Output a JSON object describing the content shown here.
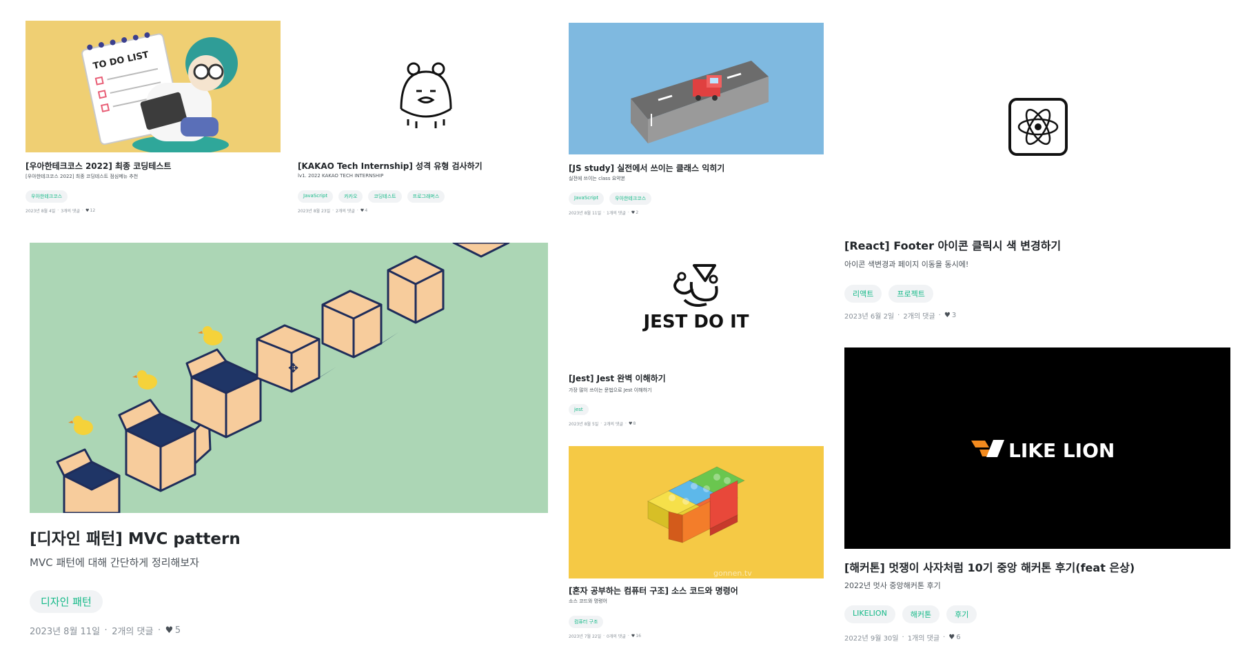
{
  "cards": [
    {
      "id": "woowa",
      "title": "[우아한테크코스 2022] 최종 코딩테스트",
      "desc": "[우아한테크코스 2022] 최종 코딩테스트 점심메뉴 추천",
      "tags": [
        "우아한테크코스"
      ],
      "date": "2023년 8월 4일",
      "comments": "3개의 댓글",
      "likes": "12",
      "thumb_text": "TO DO LIST",
      "thumb_bg": "#efcf73"
    },
    {
      "id": "kakao",
      "title": "[KAKAO Tech Internship] 성격 유형 검사하기",
      "desc": "lv1. 2022 KAKAO TECH INTERNSHIP",
      "tags": [
        "JavaScript",
        "카카오",
        "코딩테스트",
        "프로그래머스"
      ],
      "date": "2023년 8월 23일",
      "comments": "2개의 댓글",
      "likes": "4",
      "thumb_bg": "#ffffff"
    },
    {
      "id": "jsstudy",
      "title": "[JS study] 실전에서 쓰이는 클래스 익히기",
      "desc": "실전에 쓰이는 class 요약본",
      "tags": [
        "JavaScript",
        "우아한테크코스"
      ],
      "date": "2023년 8월 11일",
      "comments": "1개의 댓글",
      "likes": "2",
      "thumb_bg": "#7fb9e0"
    },
    {
      "id": "react",
      "title": "[React] Footer 아이콘 클릭시 색 변경하기",
      "desc": "아이콘 색변경과 페이지 이동을 동시에!",
      "tags": [
        "리액트",
        "프로젝트"
      ],
      "date": "2023년 6월 2일",
      "comments": "2개의 댓글",
      "likes": "3",
      "thumb_bg": "#ffffff"
    },
    {
      "id": "mvc",
      "title": "[디자인 패턴] MVC pattern",
      "desc": "MVC 패턴에 대해 간단하게 정리해보자",
      "tags": [
        "디자인 패턴"
      ],
      "date": "2023년 8월 11일",
      "comments": "2개의 댓글",
      "likes": "5",
      "thumb_bg": "#acd6b5"
    },
    {
      "id": "jest",
      "title": "[Jest] Jest 완벽 이해하기",
      "desc": "가장 많이 쓰이는 문법으로 Jest 이해하기",
      "tags": [
        "jest"
      ],
      "date": "2023년 8월 5일",
      "comments": "2개의 댓글",
      "likes": "8",
      "thumb_text": "JEST DO IT",
      "thumb_bg": "#ffffff"
    },
    {
      "id": "computer",
      "title": "[혼자 공부하는 컴퓨터 구조] 소스 코드와 명령어",
      "desc": "소스 코드와 명령어",
      "tags": [
        "컴퓨터 구조"
      ],
      "date": "2023년 7월 22일",
      "comments": "0개의 댓글",
      "likes": "16",
      "thumb_text": "gonnen.tv",
      "thumb_bg": "#f5c945"
    },
    {
      "id": "likelion",
      "title": "[해커톤] 멋쟁이 사자처럼 10기 중앙 해커톤 후기(feat 은상)",
      "desc": "2022년 멋사 중앙해커톤 후기",
      "tags": [
        "LIKELION",
        "해커톤",
        "후기"
      ],
      "date": "2022년 9월 30일",
      "comments": "1개의 댓글",
      "likes": "6",
      "thumb_text": "LIKE LION",
      "thumb_bg": "#000000"
    }
  ],
  "colors": {
    "tag_text": "#12b886",
    "tag_bg": "#f1f3f5",
    "meta_text": "#868e96"
  }
}
